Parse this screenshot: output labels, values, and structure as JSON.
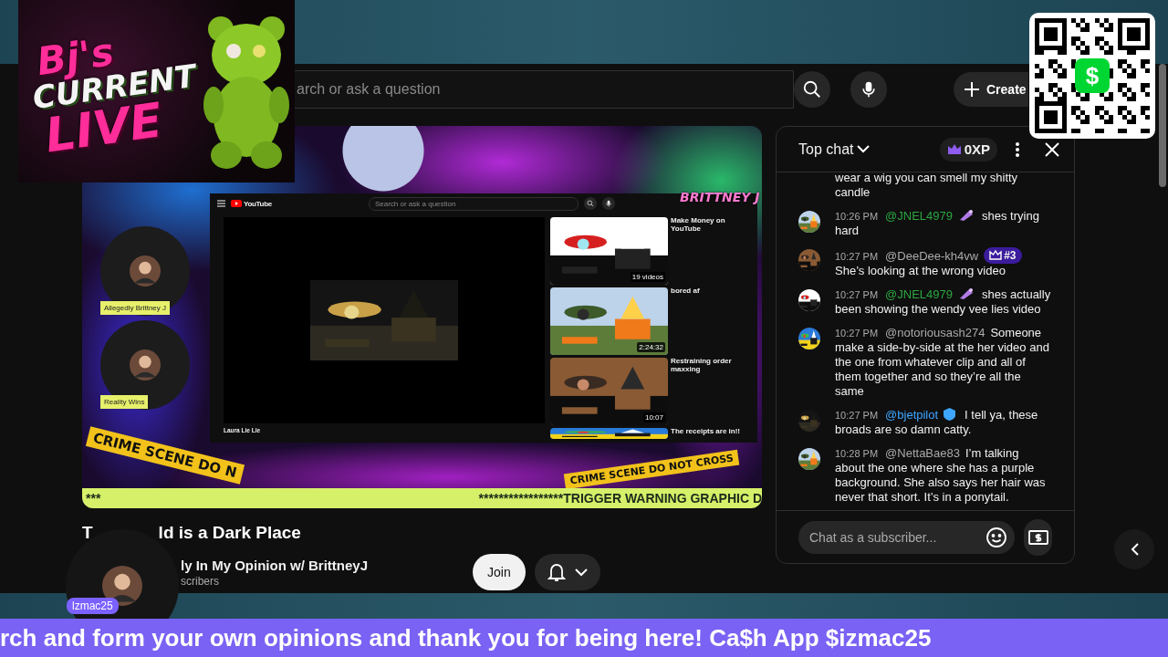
{
  "stream_logo": {
    "lines": [
      "Bj's",
      "CURRENT",
      "LIVE"
    ]
  },
  "header": {
    "search": {
      "placeholder": "arch or ask a question"
    },
    "create": {
      "label": "Create"
    }
  },
  "qr_card": {
    "symbol": "$"
  },
  "player": {
    "embedded_page": {
      "logo": "YouTube",
      "search_placeholder": "Search or ask a question",
      "video_caption": "Laura Lie Lie",
      "related": [
        {
          "title": "Make Money on YouTube",
          "badge": "19 videos"
        },
        {
          "title": "bored af",
          "badge": "2:24:32"
        },
        {
          "title": "Restraining order maxxing",
          "badge": "10:07"
        },
        {
          "title": "The receipts are in!!"
        }
      ]
    },
    "overlay_name": "BRITTNEY J",
    "guests": [
      {
        "label": "Allegedly Brittney J"
      },
      {
        "label": "Reality Wins"
      }
    ],
    "tapes": [
      "CRIME SCENE DO N",
      "CRIME SCENE DO NOT CROSS"
    ],
    "warning_band": {
      "left": "***",
      "right": "*****************TRIGGER WARNING GRAPHIC D"
    }
  },
  "video": {
    "title_parts": [
      "T",
      "ld is a Dark Place"
    ],
    "channel": "ly In My Opinion w/ BrittneyJ",
    "subscribers": "scribers",
    "join": "Join"
  },
  "chat": {
    "mode": "Top chat",
    "xp": "0XP",
    "messages": [
      {
        "kind": "continued",
        "text": "wear a wig you can smell my shitty candle"
      },
      {
        "kind": "message",
        "time": "10:26 PM",
        "author": "@JNEL4979",
        "color": "#2ba640",
        "badge": {
          "kind": "member"
        },
        "inline_text": "shes trying",
        "text": "hard"
      },
      {
        "kind": "message",
        "time": "10:27 PM",
        "author": "@DeeDee-kh4vw",
        "color": "#aaaaaa",
        "badge": {
          "kind": "rank",
          "text": "#3"
        },
        "text": "She’s looking at the wrong video"
      },
      {
        "kind": "message",
        "time": "10:27 PM",
        "author": "@JNEL4979",
        "color": "#2ba640",
        "badge": {
          "kind": "member"
        },
        "inline_text": "shes actually",
        "text": "been showing the wendy vee lies video"
      },
      {
        "kind": "message",
        "time": "10:27 PM",
        "author": "@notoriousash274",
        "color": "#aaaaaa",
        "inline_text": "Someone",
        "text": "make a side-by-side at the her video and the one from whatever clip and all of them together and so they’re all the same"
      },
      {
        "kind": "message",
        "time": "10:27 PM",
        "author": "@bjetpilot",
        "color": "#3ea6ff",
        "badge": {
          "kind": "verified"
        },
        "inline_text": "I tell ya, these",
        "text": "broads are so damn catty."
      },
      {
        "kind": "message",
        "time": "10:28 PM",
        "author": "@NettaBae83",
        "color": "#aaaaaa",
        "inline_text": "I’m talking",
        "text": "about the one where she has a purple background. She also says her hair was never that short. It’s in a ponytail."
      }
    ],
    "input": {
      "placeholder": "Chat as a subscriber..."
    }
  },
  "streamer_badge": "lzmac25",
  "ticker": "rch and form your own opinions and thank you for being here! Ca$h App $izmac25"
}
